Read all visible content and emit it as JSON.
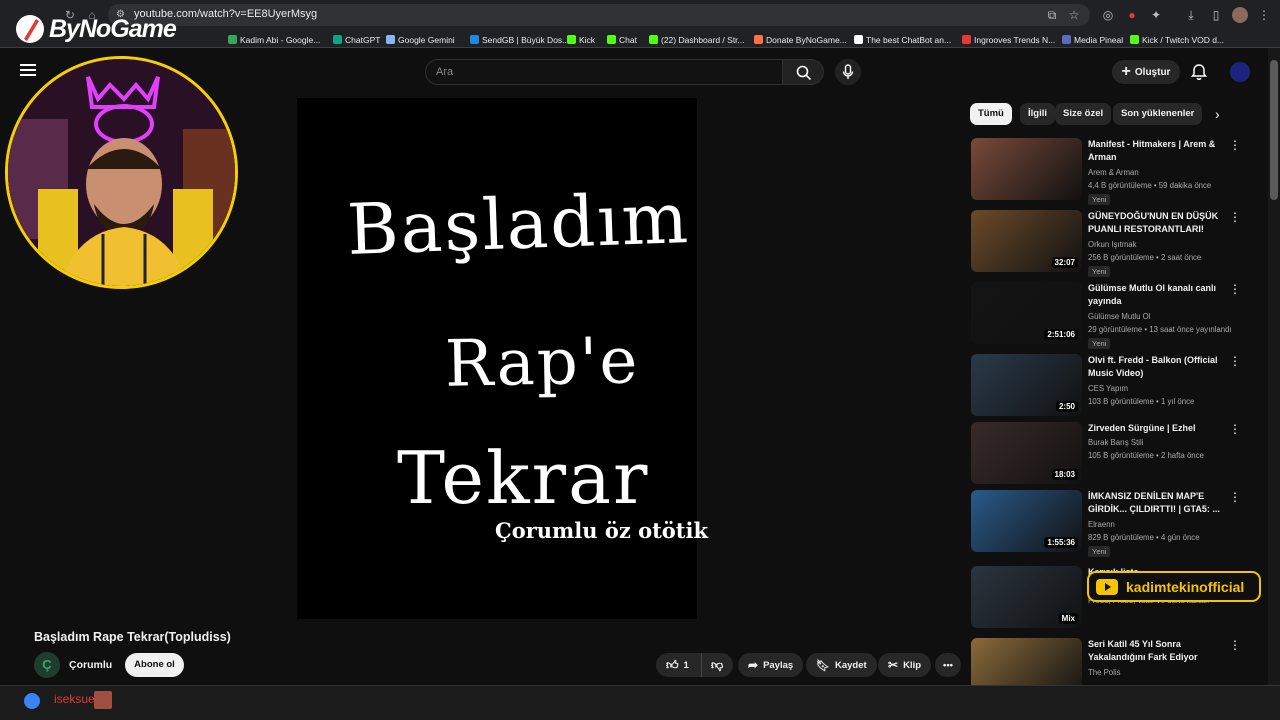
{
  "browser": {
    "url": "youtube.com/watch?v=EE8UyerMsyg",
    "bookmarks": [
      {
        "label": "Kadim Abi - Google...",
        "color": "#34a853"
      },
      {
        "label": "ChatGPT",
        "color": "#10a37f"
      },
      {
        "label": "Google Gemini",
        "color": "#8ab4f8"
      },
      {
        "label": "SendGB | Büyük Dos...",
        "color": "#1e88e5"
      },
      {
        "label": "Kick",
        "color": "#53fc18"
      },
      {
        "label": "Chat",
        "color": "#53fc18"
      },
      {
        "label": "(22) Dashboard / Str...",
        "color": "#53fc18"
      },
      {
        "label": "Donate ByNoGame...",
        "color": "#ff7043"
      },
      {
        "label": "The best ChatBot an...",
        "color": "#ffffff"
      },
      {
        "label": "Ingrooves Trends N...",
        "color": "#e53935"
      },
      {
        "label": "Media Pineal",
        "color": "#5c6bc0"
      },
      {
        "label": "Kick / Twitch VOD d...",
        "color": "#53fc18"
      }
    ]
  },
  "overlay": {
    "logo_text": "ByNoGame",
    "channel_badge": "kadimtekinofficial",
    "chat_user": "iseksuel"
  },
  "youtube": {
    "search_placeholder": "Ara",
    "create_label": "Oluştur",
    "video": {
      "title": "Başladım Rape Tekrar(Topludiss)",
      "channel": "Çorumlu",
      "channel_initial": "Ç",
      "subscribe_label": "Abone ol",
      "likes": "1",
      "share_label": "Paylaş",
      "save_label": "Kaydet",
      "clip_label": "Klip",
      "frame_lines": [
        "Başladım",
        "Rap'e",
        "Tekrar",
        "Çorumlu öz otötik"
      ]
    },
    "chips": [
      {
        "label": "Tümü",
        "active": true
      },
      {
        "label": "İlgili",
        "active": false
      },
      {
        "label": "Size özel",
        "active": false
      },
      {
        "label": "Son yüklenenler",
        "active": false
      }
    ],
    "recommendations": [
      {
        "title": "Manifest - Hitmakers | Arem & Arman",
        "channel": "Arem & Arman",
        "meta": "4,4 B görüntüleme • 59 dakika önce",
        "new": "Yeni",
        "duration": "",
        "color": "#7a4a3a"
      },
      {
        "title": "GÜNEYDOĞU'NUN EN DÜŞÜK PUANLI RESTORANTLARI!",
        "channel": "Orkun Işıtmak",
        "meta": "256 B görüntüleme • 2 saat önce",
        "new": "Yeni",
        "duration": "32:07",
        "color": "#6b4a2a"
      },
      {
        "title": "Gülümse Mutlu Ol  kanalı canlı yayında",
        "channel": "Gülümse Mutlu Ol",
        "meta": "29 görüntüleme • 13 saat önce yayınlandı",
        "new": "Yeni",
        "duration": "2:51:06",
        "color": "#141414"
      },
      {
        "title": "Olvi ft. Fredd - Balkon (Official Music Video)",
        "channel": "CES Yapım",
        "meta": "103 B görüntüleme • 1 yıl önce",
        "new": "",
        "duration": "2:50",
        "color": "#2a3a4a"
      },
      {
        "title": "Zirveden Sürgüne | Ezhel",
        "channel": "Burak Barış Stili",
        "meta": "105 B görüntüleme • 2 hafta önce",
        "new": "",
        "duration": "18:03",
        "color": "#3a2a2a"
      },
      {
        "title": "İMKANSIZ DENİLEN MAP'E GİRDİK... ÇILDIRTTI! | GTA5: ...",
        "channel": "Elraenn",
        "meta": "829 B görüntüleme • 4 gün önce",
        "new": "Yeni",
        "duration": "1:55:36",
        "color": "#2a5a8a"
      },
      {
        "title": "Karışık liste",
        "channel": "Fredd, Fredd, Tatar ve daha fazlası",
        "meta": "",
        "new": "",
        "duration": "Mix",
        "color": "#2a3540"
      },
      {
        "title": "Seri Katil 45 Yıl Sonra Yakalandığını Fark Ediyor",
        "channel": "The Polis",
        "meta": "",
        "new": "",
        "duration": "",
        "color": "#8a6a3a"
      }
    ]
  }
}
